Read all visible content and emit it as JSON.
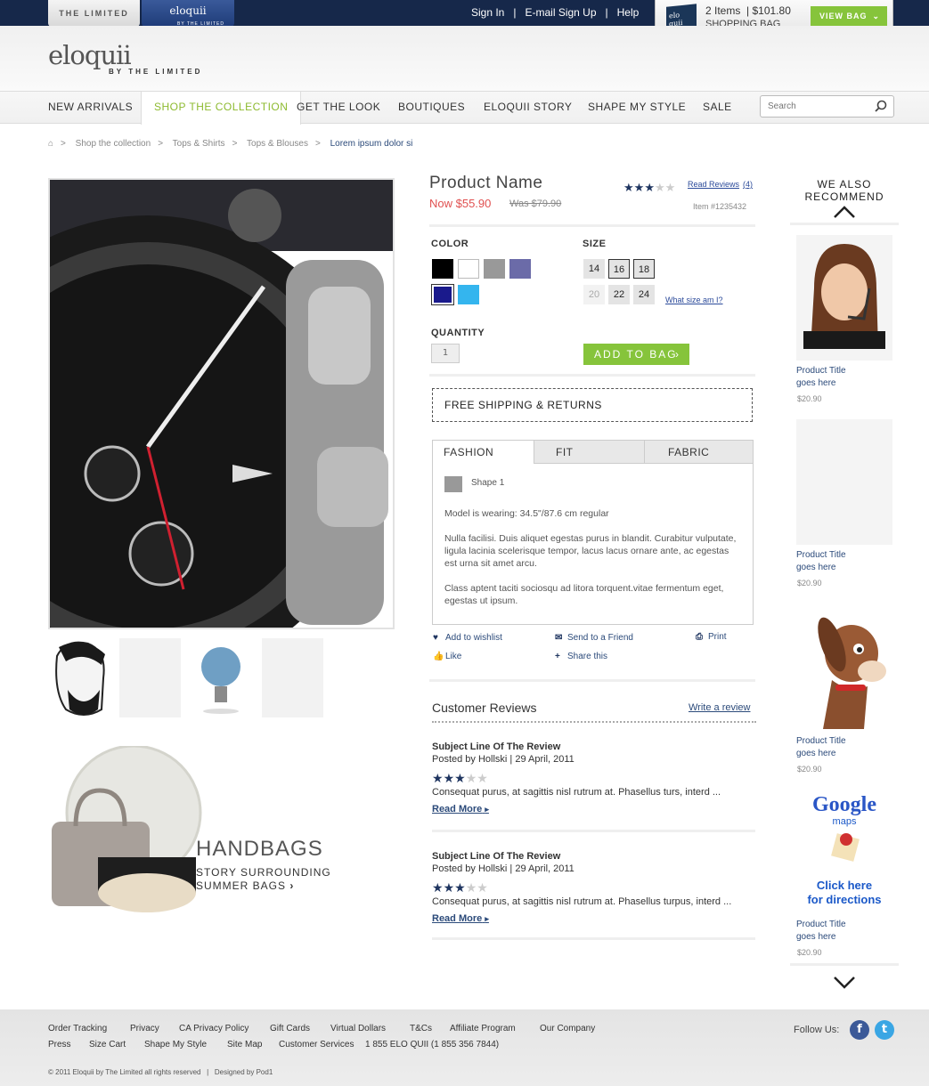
{
  "topbar": {
    "tab_limited": "THE LIMITED",
    "tab_eloquii": "eloquii",
    "tab_eloquii_sub": "BY THE LIMITED",
    "signin": "Sign In",
    "email_signup": "E-mail Sign Up",
    "help": "Help",
    "sep": "|"
  },
  "bag": {
    "items": "2 Items",
    "total": "$101.80",
    "label": "SHOPPING BAG",
    "view": "VIEW BAG",
    "icon_text": "elo quii"
  },
  "logo": {
    "name": "eloquii",
    "sub": "BY THE LIMITED"
  },
  "nav": [
    "NEW ARRIVALS",
    "SHOP THE COLLECTION",
    "GET THE LOOK",
    "BOUTIQUES",
    "ELOQUII STORY",
    "SHAPE MY STYLE",
    "SALE"
  ],
  "search": {
    "placeholder": "Search"
  },
  "breadcrumb": {
    "items": [
      "Shop the collection",
      "Tops & Shirts",
      "Tops & Blouses",
      "Lorem ipsum dolor si"
    ],
    "sep": ">"
  },
  "promo": {
    "title": "HANDBAGS",
    "line1": "STORY SURROUNDING",
    "line2": "SUMMER BAGS"
  },
  "product": {
    "name": "Product Name",
    "now": "Now $55.90",
    "was": "Was $79.90",
    "reviews_link": "Read Reviews",
    "reviews_count": "(4)",
    "rating": 3,
    "item": "Item #1235432",
    "color_label": "COLOR",
    "size_label": "SIZE",
    "colors": [
      "#000000",
      "#ffffff",
      "#999999",
      "#6b6ba8",
      "#1a1a8c",
      "#34b5ee"
    ],
    "sizes": [
      "14",
      "16",
      "18",
      "20",
      "22",
      "24"
    ],
    "size_help": "What size am I?",
    "qty_label": "QUANTITY",
    "qty": "1",
    "add": "ADD TO BAG",
    "shipping": "FREE SHIPPING & RETURNS"
  },
  "tabs": {
    "labels": [
      "FASHION",
      "FIT",
      "FABRIC"
    ],
    "shape": "Shape 1",
    "p1": "Model is wearing: 34.5\"/87.6 cm regular",
    "p2": "Nulla facilisi. Duis aliquet egestas purus in blandit. Curabitur vulputate, ligula lacinia scelerisque tempor, lacus lacus ornare ante, ac egestas est urna sit amet arcu.",
    "p3": "Class aptent taciti sociosqu ad litora torquent.vitae fermentum eget, egestas ut ipsum."
  },
  "actions": {
    "wishlist": "Add to wishlist",
    "send": "Send to a Friend",
    "print": "Print",
    "like": "Like",
    "share": "Share this"
  },
  "reviews": {
    "title": "Customer Reviews",
    "write": "Write a review",
    "items": [
      {
        "subject": "Subject Line Of The Review",
        "by": "Posted by Hollski | 29 April, 2011",
        "rating": 3,
        "text": "Consequat purus, at sagittis nisl rutrum at. Phasellus turs, interd ...",
        "more": "Read More"
      },
      {
        "subject": "Subject Line Of The Review",
        "by": "Posted by Hollski | 29 April, 2011",
        "rating": 3,
        "text": "Consequat purus, at sagittis nisl rutrum at. Phasellus turpus, interd ...",
        "more": "Read More"
      }
    ]
  },
  "recommend": {
    "title1": "WE ALSO",
    "title2": "RECOMMEND",
    "items": [
      {
        "t1": "Product Title",
        "t2": "goes here",
        "price": "$20.90"
      },
      {
        "t1": "Product Title",
        "t2": "goes here",
        "price": "$20.90"
      },
      {
        "t1": "Product Title",
        "t2": "goes here",
        "price": "$20.90"
      },
      {
        "t1": "Product Title",
        "t2": "goes here",
        "price": "$20.90"
      }
    ],
    "maps_word": "Google",
    "maps_sub": "maps",
    "maps_cta1": "Click here",
    "maps_cta2": "for directions"
  },
  "footer": {
    "row1": [
      "Order Tracking",
      "Privacy",
      "CA Privacy Policy",
      "Gift Cards",
      "Virtual Dollars",
      "T&Cs",
      "Affiliate Program",
      "Our Company"
    ],
    "row2": [
      "Press",
      "Size Cart",
      "Shape My Style",
      "Site Map",
      "Customer Services"
    ],
    "phone": "1 855 ELO QUII (1 855 356 7844)",
    "copyright": "© 2011 Eloquii by The Limited all rights reserved",
    "copy_sep": "|",
    "designed": "Designed by Pod1",
    "follow": "Follow Us:"
  }
}
